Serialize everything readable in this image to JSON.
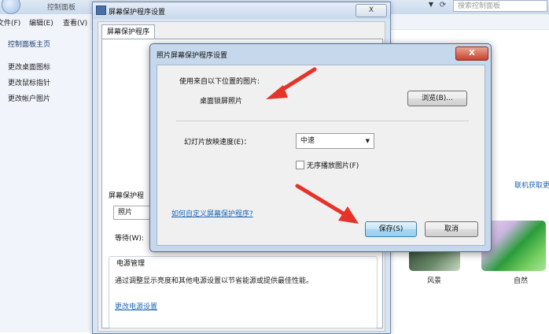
{
  "control_panel": {
    "breadcrumb": "控制面板",
    "search_placeholder": "搜索控制面板",
    "menu": [
      "文件(F)",
      "编辑(E)",
      "查看(V)"
    ],
    "sidebar_title": "控制面板主页",
    "sidebar_items": [
      "更改桌面图标",
      "更改鼠标指针",
      "更改帐户图片"
    ],
    "right_link": "联机获取更",
    "themes": [
      {
        "label": "风景"
      },
      {
        "label": "自然"
      }
    ]
  },
  "screensaver_dialog": {
    "title": "屏幕保护程序设置",
    "close_label": "X",
    "tab": "屏幕保护程序",
    "group_label": "屏幕保护程",
    "selected": "照片",
    "wait_label": "等待(W):",
    "power": {
      "title": "电源管理",
      "description": "通过调整显示亮度和其他电源设置以节省能源或提供最佳性能。",
      "link": "更改电源设置"
    }
  },
  "photo_dialog": {
    "title": "照片屏幕保护程序设置",
    "close_label": "X",
    "use_pictures_label": "使用来自以下位置的图片:",
    "folder_name": "桌面锁屏照片",
    "browse_button": "浏览(B)...",
    "speed_label": "幻灯片放映速度(E)：",
    "speed_value": "中速",
    "shuffle_label": "无序播放图片(F)",
    "shuffle_checked": false,
    "help_link": "如何自定义屏幕保护程序?",
    "save_button": "保存(S)",
    "cancel_button": "取消"
  },
  "colors": {
    "annotation_arrow": "#e5332a",
    "link": "#1e66b6"
  }
}
